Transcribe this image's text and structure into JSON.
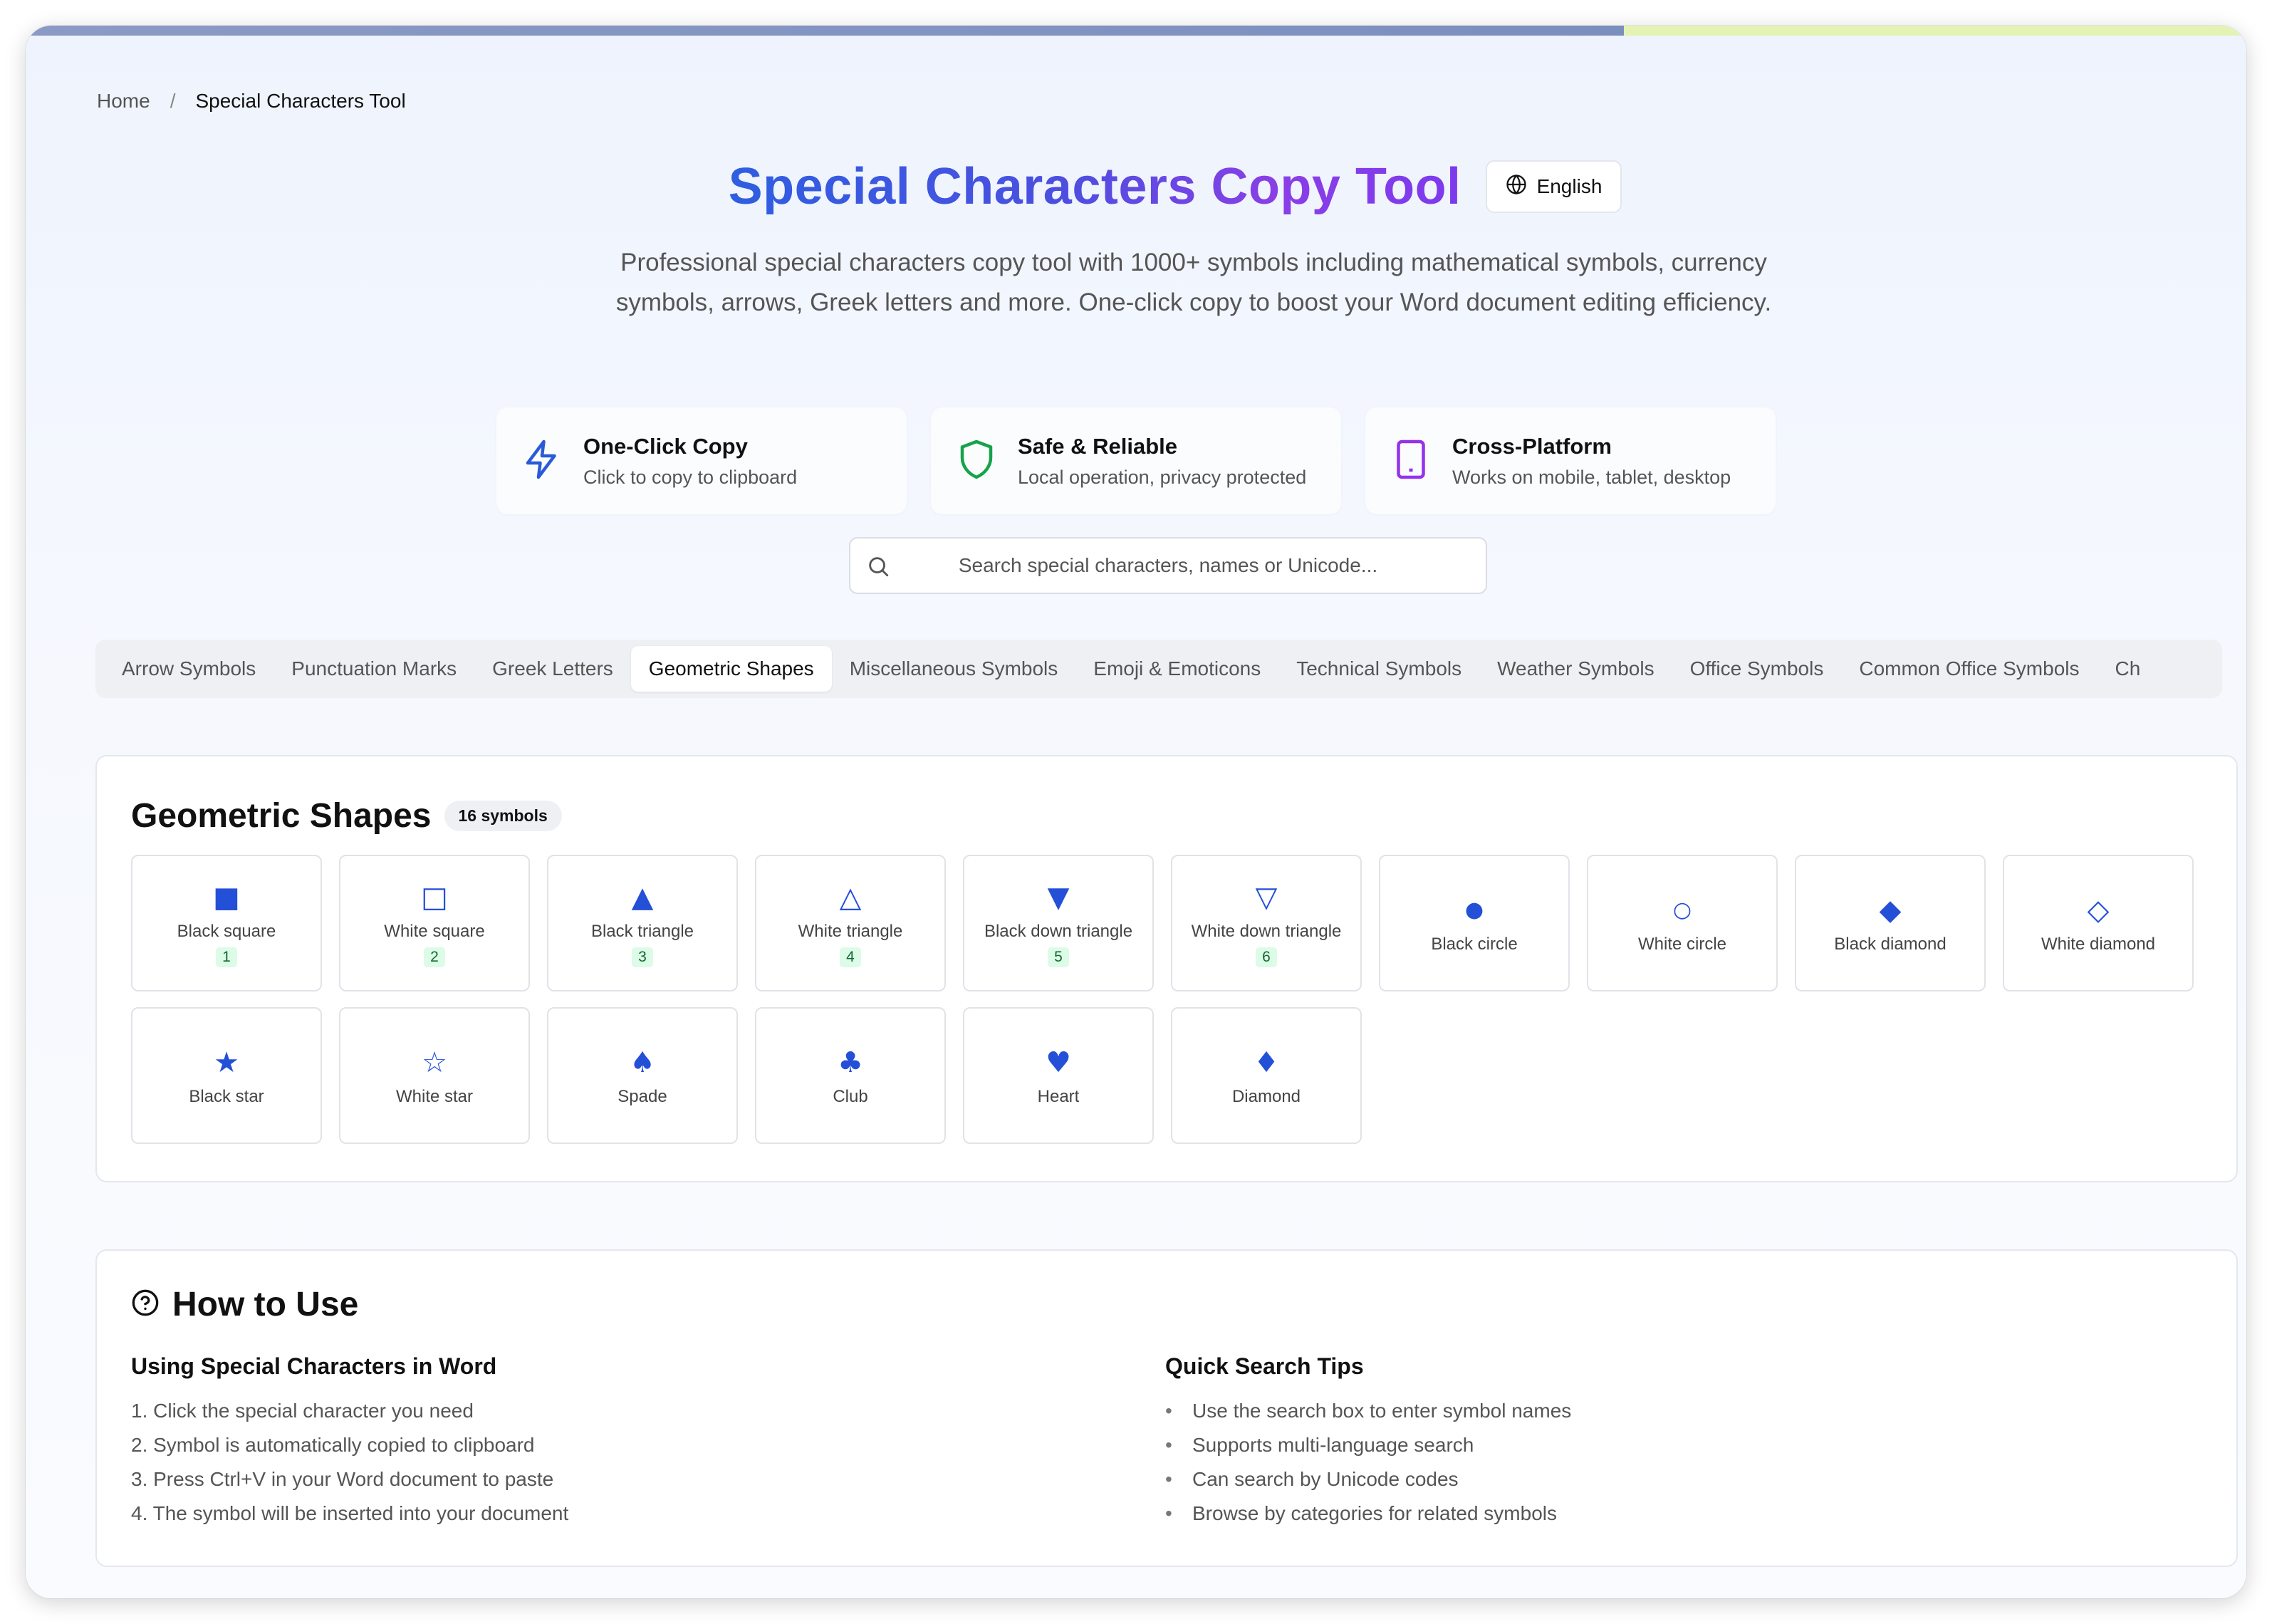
{
  "breadcrumb": {
    "home": "Home",
    "separator": "/",
    "current": "Special Characters Tool"
  },
  "hero": {
    "title": "Special Characters Copy Tool",
    "language": "English",
    "subtitle": "Professional special characters copy tool with 1000+ symbols including mathematical symbols, currency symbols, arrows, Greek letters and more. One-click copy to boost your Word document editing efficiency."
  },
  "features": [
    {
      "icon": "lightning-icon",
      "title": "One-Click Copy",
      "desc": "Click to copy to clipboard",
      "color": "#2a5bd7"
    },
    {
      "icon": "shield-icon",
      "title": "Safe & Reliable",
      "desc": "Local operation, privacy protected",
      "color": "#16a34a"
    },
    {
      "icon": "tablet-icon",
      "title": "Cross-Platform",
      "desc": "Works on mobile, tablet, desktop",
      "color": "#9333ea"
    }
  ],
  "search": {
    "placeholder": "Search special characters, names or Unicode..."
  },
  "tabs": [
    "Arrow Symbols",
    "Punctuation Marks",
    "Greek Letters",
    "Geometric Shapes",
    "Miscellaneous Symbols",
    "Emoji & Emoticons",
    "Technical Symbols",
    "Weather Symbols",
    "Office Symbols",
    "Common Office Symbols",
    "Ch"
  ],
  "active_tab": "Geometric Shapes",
  "section": {
    "title": "Geometric Shapes",
    "count": "16 symbols",
    "symbols": [
      {
        "char": "■",
        "name": "Black square",
        "num": "1"
      },
      {
        "char": "□",
        "name": "White square",
        "num": "2"
      },
      {
        "char": "▲",
        "name": "Black triangle",
        "num": "3"
      },
      {
        "char": "△",
        "name": "White triangle",
        "num": "4"
      },
      {
        "char": "▼",
        "name": "Black down triangle",
        "num": "5"
      },
      {
        "char": "▽",
        "name": "White down triangle",
        "num": "6"
      },
      {
        "char": "●",
        "name": "Black circle",
        "num": ""
      },
      {
        "char": "○",
        "name": "White circle",
        "num": ""
      },
      {
        "char": "◆",
        "name": "Black diamond",
        "num": ""
      },
      {
        "char": "◇",
        "name": "White diamond",
        "num": ""
      },
      {
        "char": "★",
        "name": "Black star",
        "num": ""
      },
      {
        "char": "☆",
        "name": "White star",
        "num": ""
      },
      {
        "char": "♠",
        "name": "Spade",
        "num": ""
      },
      {
        "char": "♣",
        "name": "Club",
        "num": ""
      },
      {
        "char": "♥",
        "name": "Heart",
        "num": ""
      },
      {
        "char": "♦",
        "name": "Diamond",
        "num": ""
      }
    ]
  },
  "howto": {
    "title": "How to Use",
    "left": {
      "heading": "Using Special Characters in Word",
      "items": [
        "1. Click the special character you need",
        "2. Symbol is automatically copied to clipboard",
        "3. Press Ctrl+V in your Word document to paste",
        "4. The symbol will be inserted into your document"
      ]
    },
    "right": {
      "heading": "Quick Search Tips",
      "items": [
        "Use the search box to enter symbol names",
        "Supports multi-language search",
        "Can search by Unicode codes",
        "Browse by categories for related symbols"
      ]
    }
  }
}
